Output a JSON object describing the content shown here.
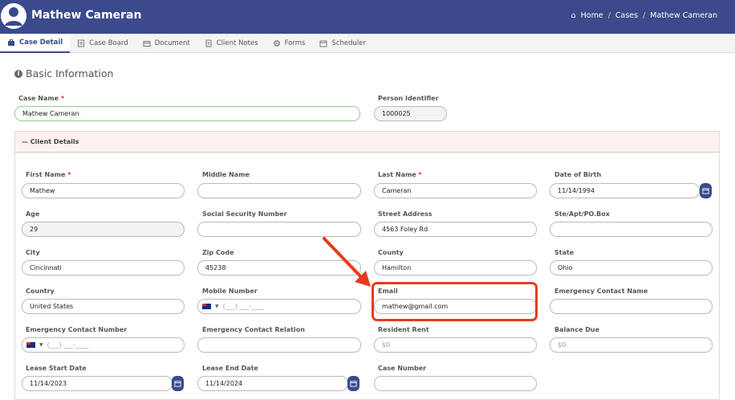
{
  "header": {
    "title": "Mathew Cameran",
    "breadcrumbs": [
      "Home",
      "Cases",
      "Mathew Cameran"
    ]
  },
  "tabs": [
    {
      "label": "Case Detail",
      "icon": "briefcase-icon",
      "active": true
    },
    {
      "label": "Case Board",
      "icon": "board-icon"
    },
    {
      "label": "Document",
      "icon": "folder-icon"
    },
    {
      "label": "Client Notes",
      "icon": "notes-icon"
    },
    {
      "label": "Forms",
      "icon": "forms-icon"
    },
    {
      "label": "Scheduler",
      "icon": "calendar-icon"
    }
  ],
  "basic": {
    "title": "Basic Information",
    "case_name_label": "Case Name",
    "case_name_value": "Mathew Cameran",
    "person_identifier_label": "Person Identifier",
    "person_identifier_value": "1000025"
  },
  "client_details": {
    "title": "Client Details",
    "first_name_label": "First Name",
    "first_name": "Mathew",
    "middle_name_label": "Middle Name",
    "middle_name": "",
    "last_name_label": "Last Name",
    "last_name": "Cameran",
    "dob_label": "Date of Birth",
    "dob": "11/14/1994",
    "age_label": "Age",
    "age": "29",
    "ssn_label": "Social Security Number",
    "ssn": "",
    "street_label": "Street Address",
    "street": "4563 Foley Rd",
    "apt_label": "Ste/Apt/PO.Box",
    "apt": "",
    "city_label": "City",
    "city": "Cincinnati",
    "zip_label": "Zip Code",
    "zip": "45238",
    "county_label": "County",
    "county": "Hamilton",
    "state_label": "State",
    "state": "Ohio",
    "country_label": "Country",
    "country": "United States",
    "mobile_label": "Mobile Number",
    "mobile_placeholder": "(___) ___-____",
    "email_label": "Email",
    "email": "mathew@gmail.com",
    "emergency_name_label": "Emergency Contact Name",
    "emergency_name": "",
    "emergency_number_label": "Emergency Contact Number",
    "emergency_number_placeholder": "(___) ___-____",
    "emergency_relation_label": "Emergency Contact Relation",
    "emergency_relation": "",
    "resident_rent_label": "Resident Rent",
    "resident_rent_placeholder": "$0",
    "balance_due_label": "Balance Due",
    "balance_due_placeholder": "$0",
    "lease_start_label": "Lease Start Date",
    "lease_start": "11/14/2023",
    "lease_end_label": "Lease End Date",
    "lease_end": "11/14/2024",
    "case_number_label": "Case Number",
    "case_number": ""
  },
  "colors": {
    "primary": "#3b4a8c",
    "highlight": "#e63b1f",
    "required": "#e03131"
  }
}
